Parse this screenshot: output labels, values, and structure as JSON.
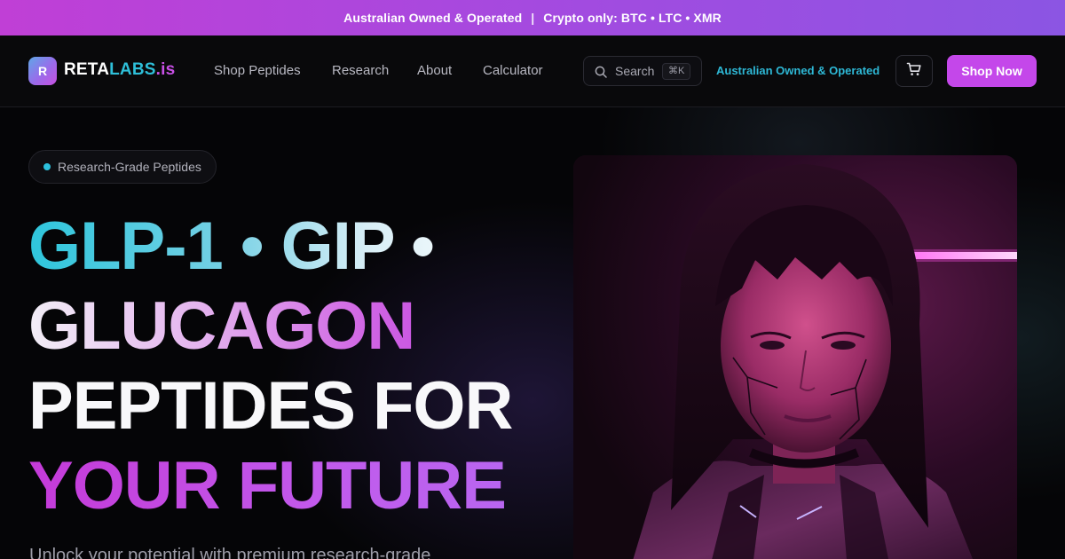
{
  "announcement": {
    "left": "Australian Owned & Operated",
    "separator": "|",
    "right": "Crypto only: BTC • LTC • XMR"
  },
  "header": {
    "logo_badge": "R",
    "logo_part1": "RETA",
    "logo_part2": "LABS",
    "logo_part3": ".is",
    "nav": [
      "Shop Peptides",
      "Research",
      "About",
      "Calculator"
    ],
    "search_label": "Search",
    "search_shortcut": "⌘K",
    "au_badge": "Australian Owned & Operated",
    "shop_button": "Shop Now",
    "icons": {
      "search": "search-icon",
      "cart": "cart-icon"
    }
  },
  "hero": {
    "pill_label": "Research-Grade Peptides",
    "headline_line1": "GLP-1 • GIP •",
    "headline_line2": "GLUCAGON",
    "headline_line3": "PEPTIDES FOR",
    "headline_line4": "YOUR FUTURE",
    "subtitle": "Unlock your potential with premium research-grade"
  },
  "colors": {
    "accent_magenta": "#c447ea",
    "accent_cyan": "#2ebfd9",
    "background": "#07070a"
  }
}
